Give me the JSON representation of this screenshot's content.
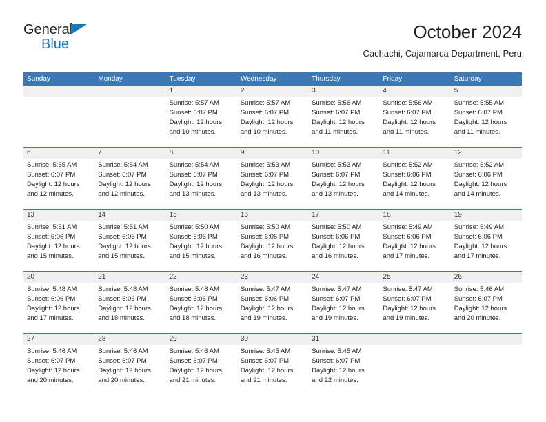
{
  "brand": {
    "name_part1": "General",
    "name_part2": "Blue",
    "triangle_icon": "brand-triangle-icon",
    "colors": {
      "dark": "#231f20",
      "blue": "#1878be"
    }
  },
  "header": {
    "title": "October 2024",
    "subtitle": "Cachachi, Cajamarca Department, Peru"
  },
  "calendar": {
    "accent_color": "#3c78b4",
    "daynum_band_color": "#f0f0f0",
    "weekday_headers": [
      "Sunday",
      "Monday",
      "Tuesday",
      "Wednesday",
      "Thursday",
      "Friday",
      "Saturday"
    ],
    "weeks": [
      {
        "days": [
          {
            "num": "",
            "lines": []
          },
          {
            "num": "",
            "lines": []
          },
          {
            "num": "1",
            "lines": [
              "Sunrise: 5:57 AM",
              "Sunset: 6:07 PM",
              "Daylight: 12 hours",
              "and 10 minutes."
            ]
          },
          {
            "num": "2",
            "lines": [
              "Sunrise: 5:57 AM",
              "Sunset: 6:07 PM",
              "Daylight: 12 hours",
              "and 10 minutes."
            ]
          },
          {
            "num": "3",
            "lines": [
              "Sunrise: 5:56 AM",
              "Sunset: 6:07 PM",
              "Daylight: 12 hours",
              "and 11 minutes."
            ]
          },
          {
            "num": "4",
            "lines": [
              "Sunrise: 5:56 AM",
              "Sunset: 6:07 PM",
              "Daylight: 12 hours",
              "and 11 minutes."
            ]
          },
          {
            "num": "5",
            "lines": [
              "Sunrise: 5:55 AM",
              "Sunset: 6:07 PM",
              "Daylight: 12 hours",
              "and 11 minutes."
            ]
          }
        ]
      },
      {
        "days": [
          {
            "num": "6",
            "lines": [
              "Sunrise: 5:55 AM",
              "Sunset: 6:07 PM",
              "Daylight: 12 hours",
              "and 12 minutes."
            ]
          },
          {
            "num": "7",
            "lines": [
              "Sunrise: 5:54 AM",
              "Sunset: 6:07 PM",
              "Daylight: 12 hours",
              "and 12 minutes."
            ]
          },
          {
            "num": "8",
            "lines": [
              "Sunrise: 5:54 AM",
              "Sunset: 6:07 PM",
              "Daylight: 12 hours",
              "and 13 minutes."
            ]
          },
          {
            "num": "9",
            "lines": [
              "Sunrise: 5:53 AM",
              "Sunset: 6:07 PM",
              "Daylight: 12 hours",
              "and 13 minutes."
            ]
          },
          {
            "num": "10",
            "lines": [
              "Sunrise: 5:53 AM",
              "Sunset: 6:07 PM",
              "Daylight: 12 hours",
              "and 13 minutes."
            ]
          },
          {
            "num": "11",
            "lines": [
              "Sunrise: 5:52 AM",
              "Sunset: 6:06 PM",
              "Daylight: 12 hours",
              "and 14 minutes."
            ]
          },
          {
            "num": "12",
            "lines": [
              "Sunrise: 5:52 AM",
              "Sunset: 6:06 PM",
              "Daylight: 12 hours",
              "and 14 minutes."
            ]
          }
        ]
      },
      {
        "days": [
          {
            "num": "13",
            "lines": [
              "Sunrise: 5:51 AM",
              "Sunset: 6:06 PM",
              "Daylight: 12 hours",
              "and 15 minutes."
            ]
          },
          {
            "num": "14",
            "lines": [
              "Sunrise: 5:51 AM",
              "Sunset: 6:06 PM",
              "Daylight: 12 hours",
              "and 15 minutes."
            ]
          },
          {
            "num": "15",
            "lines": [
              "Sunrise: 5:50 AM",
              "Sunset: 6:06 PM",
              "Daylight: 12 hours",
              "and 15 minutes."
            ]
          },
          {
            "num": "16",
            "lines": [
              "Sunrise: 5:50 AM",
              "Sunset: 6:06 PM",
              "Daylight: 12 hours",
              "and 16 minutes."
            ]
          },
          {
            "num": "17",
            "lines": [
              "Sunrise: 5:50 AM",
              "Sunset: 6:06 PM",
              "Daylight: 12 hours",
              "and 16 minutes."
            ]
          },
          {
            "num": "18",
            "lines": [
              "Sunrise: 5:49 AM",
              "Sunset: 6:06 PM",
              "Daylight: 12 hours",
              "and 17 minutes."
            ]
          },
          {
            "num": "19",
            "lines": [
              "Sunrise: 5:49 AM",
              "Sunset: 6:06 PM",
              "Daylight: 12 hours",
              "and 17 minutes."
            ]
          }
        ]
      },
      {
        "days": [
          {
            "num": "20",
            "lines": [
              "Sunrise: 5:48 AM",
              "Sunset: 6:06 PM",
              "Daylight: 12 hours",
              "and 17 minutes."
            ]
          },
          {
            "num": "21",
            "lines": [
              "Sunrise: 5:48 AM",
              "Sunset: 6:06 PM",
              "Daylight: 12 hours",
              "and 18 minutes."
            ]
          },
          {
            "num": "22",
            "lines": [
              "Sunrise: 5:48 AM",
              "Sunset: 6:06 PM",
              "Daylight: 12 hours",
              "and 18 minutes."
            ]
          },
          {
            "num": "23",
            "lines": [
              "Sunrise: 5:47 AM",
              "Sunset: 6:06 PM",
              "Daylight: 12 hours",
              "and 19 minutes."
            ]
          },
          {
            "num": "24",
            "lines": [
              "Sunrise: 5:47 AM",
              "Sunset: 6:07 PM",
              "Daylight: 12 hours",
              "and 19 minutes."
            ]
          },
          {
            "num": "25",
            "lines": [
              "Sunrise: 5:47 AM",
              "Sunset: 6:07 PM",
              "Daylight: 12 hours",
              "and 19 minutes."
            ]
          },
          {
            "num": "26",
            "lines": [
              "Sunrise: 5:46 AM",
              "Sunset: 6:07 PM",
              "Daylight: 12 hours",
              "and 20 minutes."
            ]
          }
        ]
      },
      {
        "days": [
          {
            "num": "27",
            "lines": [
              "Sunrise: 5:46 AM",
              "Sunset: 6:07 PM",
              "Daylight: 12 hours",
              "and 20 minutes."
            ]
          },
          {
            "num": "28",
            "lines": [
              "Sunrise: 5:46 AM",
              "Sunset: 6:07 PM",
              "Daylight: 12 hours",
              "and 20 minutes."
            ]
          },
          {
            "num": "29",
            "lines": [
              "Sunrise: 5:46 AM",
              "Sunset: 6:07 PM",
              "Daylight: 12 hours",
              "and 21 minutes."
            ]
          },
          {
            "num": "30",
            "lines": [
              "Sunrise: 5:45 AM",
              "Sunset: 6:07 PM",
              "Daylight: 12 hours",
              "and 21 minutes."
            ]
          },
          {
            "num": "31",
            "lines": [
              "Sunrise: 5:45 AM",
              "Sunset: 6:07 PM",
              "Daylight: 12 hours",
              "and 22 minutes."
            ]
          },
          {
            "num": "",
            "lines": []
          },
          {
            "num": "",
            "lines": []
          }
        ]
      }
    ]
  }
}
